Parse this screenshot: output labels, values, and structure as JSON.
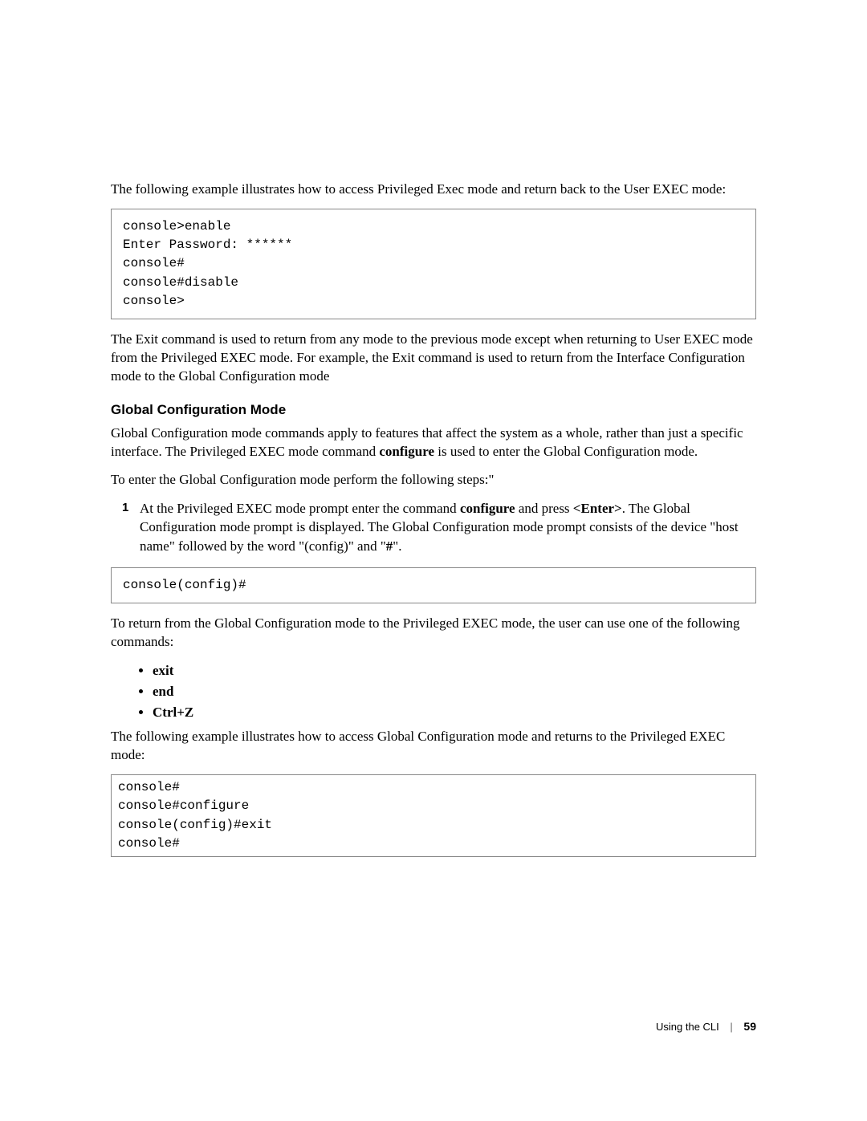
{
  "intro1": "The following example illustrates how to access Privileged Exec mode and return back to the User EXEC mode:",
  "code1": "console>enable\nEnter Password: ******\nconsole#\nconsole#disable\nconsole>",
  "exit_para": "The Exit command is used to return from any mode to the previous mode except when returning to User EXEC mode from the Privileged EXEC mode. For example, the Exit command is used to return from the Interface Configuration mode to the Global Configuration mode",
  "heading_gcm": "Global Configuration Mode",
  "gcm_p1_a": "Global Configuration mode commands apply to features that affect the system as a whole, rather than just a specific interface. The Privileged EXEC mode command ",
  "gcm_p1_bold": "configure",
  "gcm_p1_b": " is used to enter the Global Configuration mode.",
  "gcm_p2": "To enter the Global Configuration mode perform the following steps:\"",
  "step1_marker": "1",
  "step1_a": "At the Privileged EXEC mode prompt enter the command ",
  "step1_bold1": "configure",
  "step1_b": " and press ",
  "step1_bold2": "<Enter>",
  "step1_c": ". The Global Configuration mode prompt is displayed. The Global Configuration mode prompt consists of the device \"host name\" followed by the word \"(config)\" and \"",
  "step1_bold3": "#",
  "step1_d": "\".",
  "code2": "console(config)#",
  "return_p": "To return from the Global Configuration mode to the Privileged EXEC mode, the user can use one of the following commands:",
  "bullets": {
    "b1": "exit",
    "b2": "end",
    "b3": "Ctrl+Z"
  },
  "example2_p": "The following example illustrates how to access Global Configuration mode and returns to the Privileged EXEC mode:",
  "code3": "console#\nconsole#configure\nconsole(config)#exit\nconsole#",
  "footer_label": "Using the CLI",
  "footer_page": "59"
}
